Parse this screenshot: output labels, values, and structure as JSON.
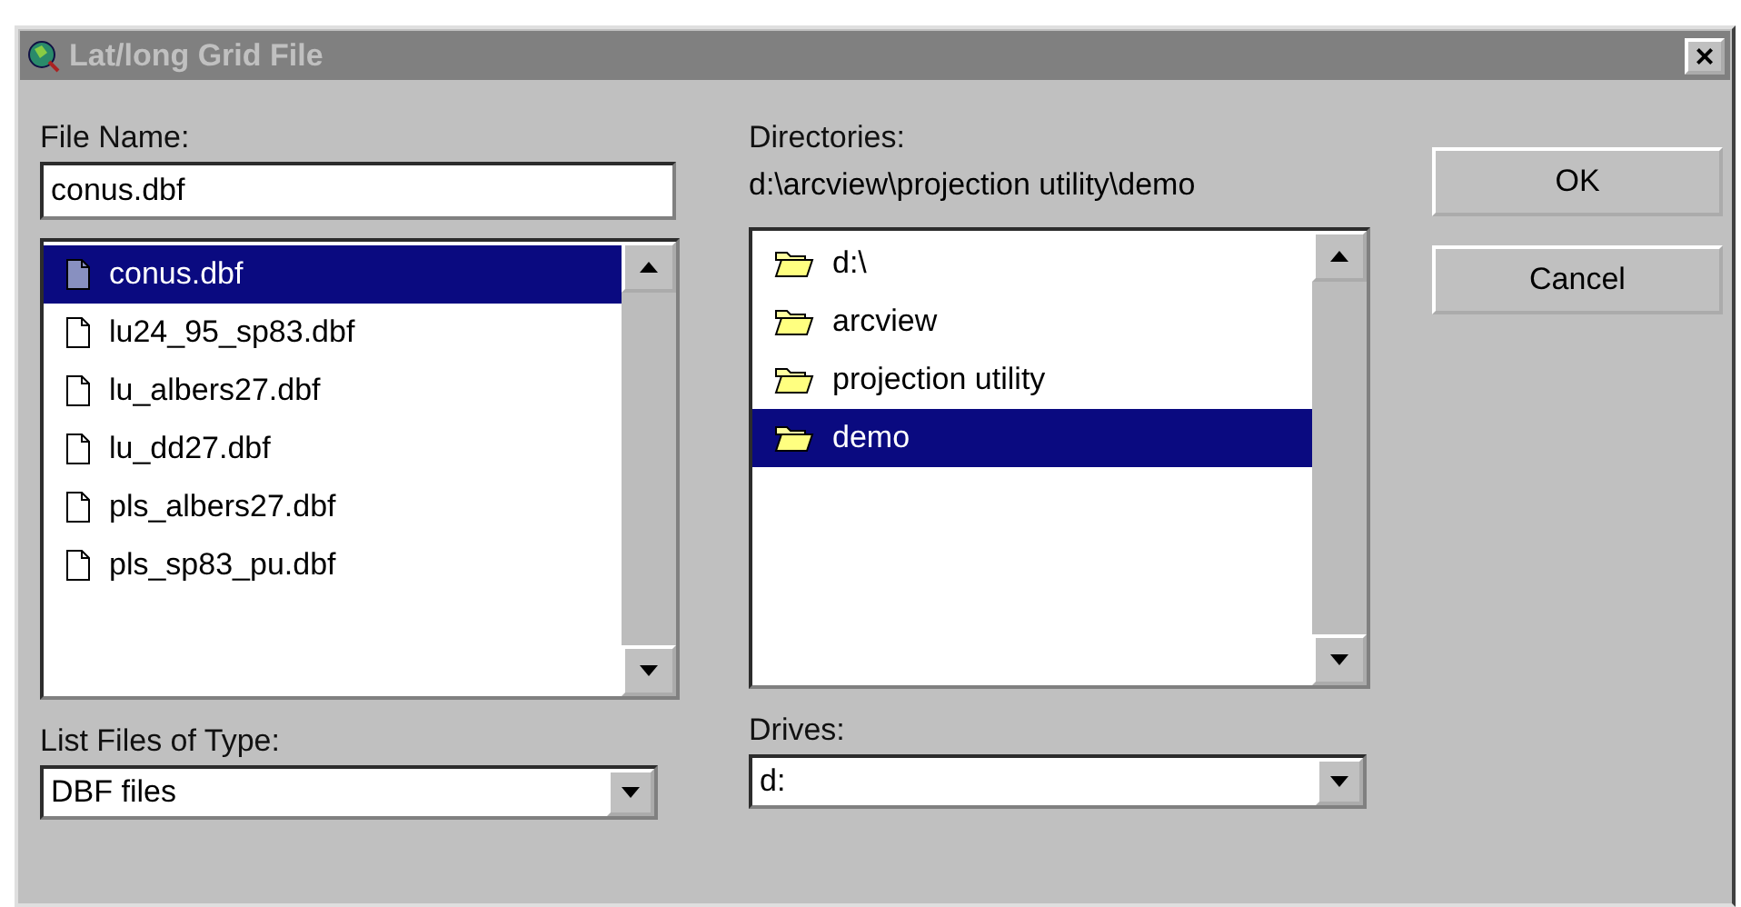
{
  "window": {
    "title": "Lat/long Grid File",
    "close": "×"
  },
  "file_name": {
    "label": "File Name:",
    "value": "conus.dbf"
  },
  "files": [
    {
      "name": "conus.dbf",
      "selected": true
    },
    {
      "name": "lu24_95_sp83.dbf",
      "selected": false
    },
    {
      "name": "lu_albers27.dbf",
      "selected": false
    },
    {
      "name": "lu_dd27.dbf",
      "selected": false
    },
    {
      "name": "pls_albers27.dbf",
      "selected": false
    },
    {
      "name": "pls_sp83_pu.dbf",
      "selected": false
    }
  ],
  "directories": {
    "label": "Directories:",
    "path": "d:\\arcview\\projection utility\\demo"
  },
  "folders": [
    {
      "name": "d:\\",
      "selected": false
    },
    {
      "name": "arcview",
      "selected": false
    },
    {
      "name": "projection utility",
      "selected": false
    },
    {
      "name": "demo",
      "selected": true
    }
  ],
  "file_type": {
    "label": "List Files of Type:",
    "value": "DBF files"
  },
  "drives": {
    "label": "Drives:",
    "value": "d:"
  },
  "buttons": [
    "OK",
    "Cancel"
  ]
}
